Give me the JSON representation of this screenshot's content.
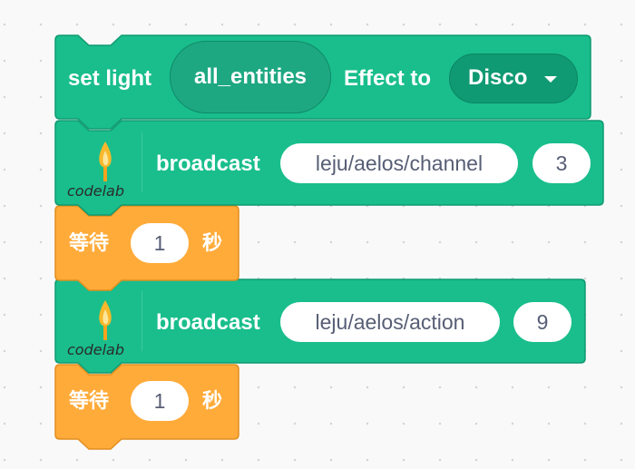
{
  "blocks": {
    "set_light": {
      "label_prefix": "set light",
      "entity": "all_entities",
      "label_mid": "Effect to",
      "effect_value": "Disco"
    },
    "broadcast_1": {
      "icon_text": "codelab",
      "label": "broadcast",
      "topic": "leju/aelos/channel",
      "value": "3"
    },
    "wait_1": {
      "label": "等待",
      "value": "1",
      "unit": "秒"
    },
    "broadcast_2": {
      "icon_text": "codelab",
      "label": "broadcast",
      "topic": "leju/aelos/action",
      "value": "9"
    },
    "wait_2": {
      "label": "等待",
      "value": "1",
      "unit": "秒"
    }
  },
  "colors": {
    "background": "#f9f9f9",
    "green_block": "#19be8c",
    "green_border": "#0f9a70",
    "orange_block": "#ffab3a",
    "orange_border": "#e28e1e",
    "input_text": "#575e75"
  },
  "icons": [
    "flame-icon",
    "caret-down-icon"
  ]
}
